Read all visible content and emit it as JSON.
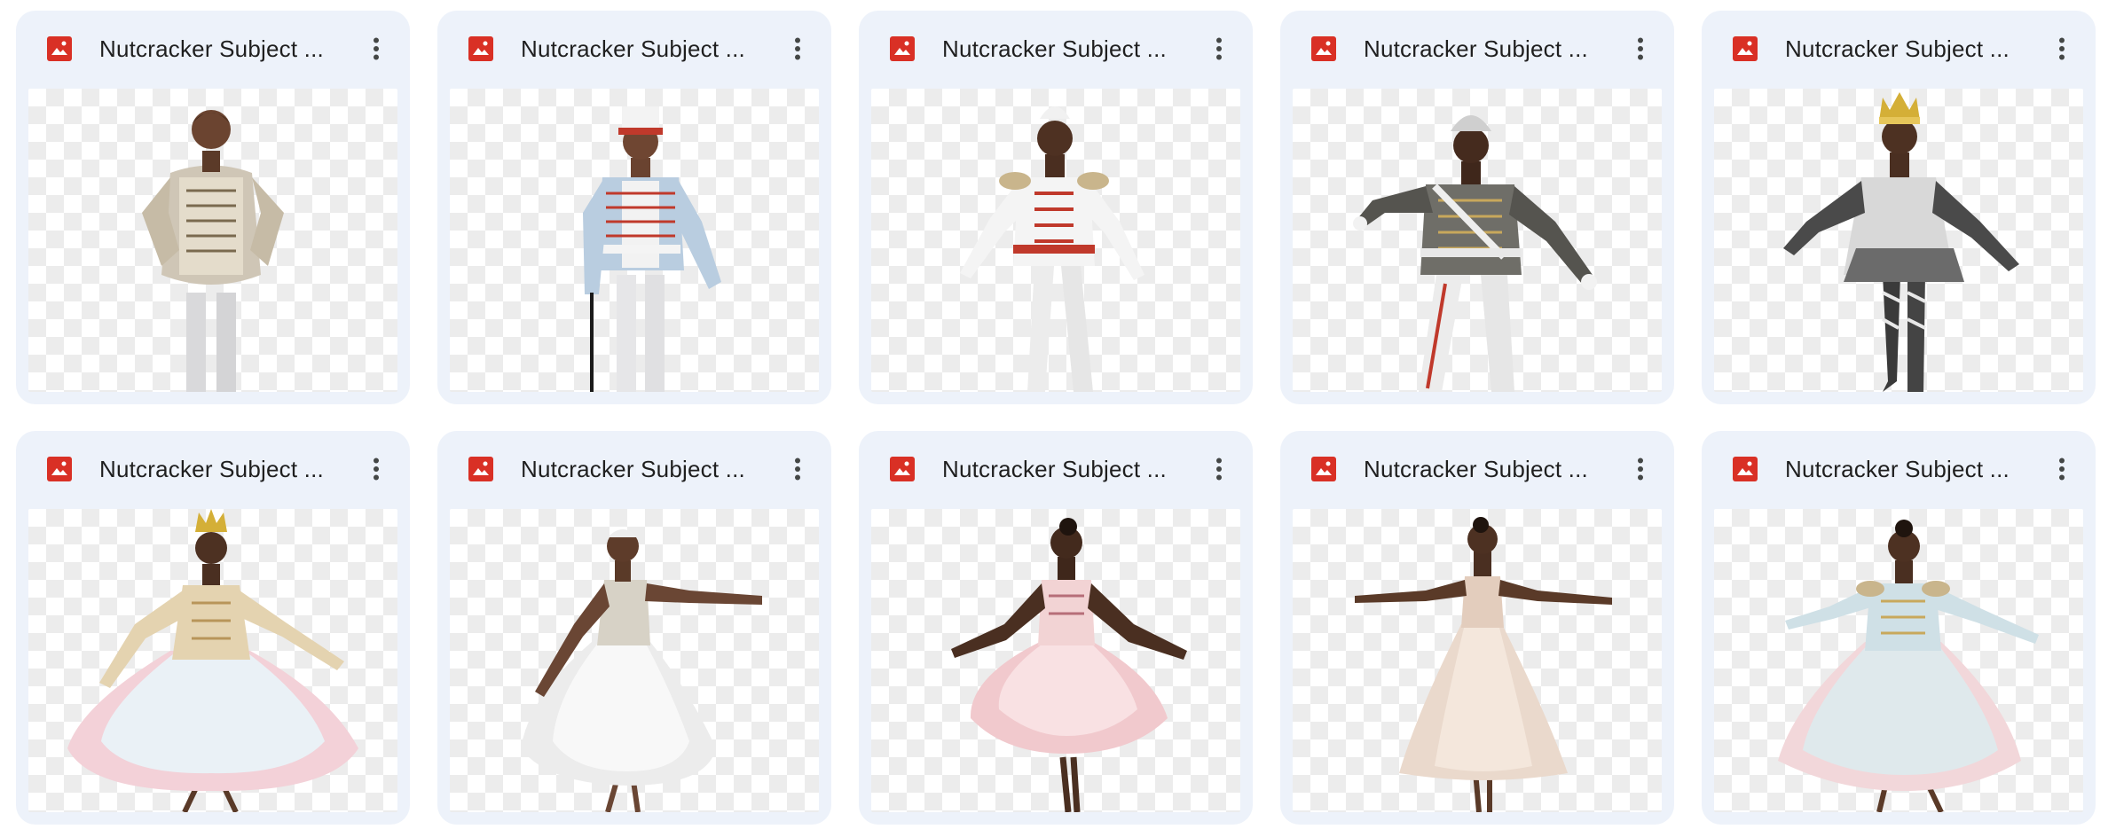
{
  "files": [
    {
      "title": "Nutcracker Subject ...",
      "icon": "image-file-icon",
      "figure": "boy-cream-jacket"
    },
    {
      "title": "Nutcracker Subject ...",
      "icon": "image-file-icon",
      "figure": "boy-soldier-blue-cane"
    },
    {
      "title": "Nutcracker Subject ...",
      "icon": "image-file-icon",
      "figure": "boy-red-white-uniform"
    },
    {
      "title": "Nutcracker Subject ...",
      "icon": "image-file-icon",
      "figure": "boy-grey-gold-uniform"
    },
    {
      "title": "Nutcracker Subject ...",
      "icon": "image-file-icon",
      "figure": "boy-crown-striped"
    },
    {
      "title": "Nutcracker Subject ...",
      "icon": "image-file-icon",
      "figure": "girl-crown-pink-dress"
    },
    {
      "title": "Nutcracker Subject ...",
      "icon": "image-file-icon",
      "figure": "girl-white-tutu"
    },
    {
      "title": "Nutcracker Subject ...",
      "icon": "image-file-icon",
      "figure": "girl-pink-tutu"
    },
    {
      "title": "Nutcracker Subject ...",
      "icon": "image-file-icon",
      "figure": "girl-beige-dress"
    },
    {
      "title": "Nutcracker Subject ...",
      "icon": "image-file-icon",
      "figure": "girl-blue-jacket-dress"
    }
  ],
  "colors": {
    "card_bg": "#edf2fa",
    "icon_red": "#d93025",
    "title_text": "#1f1f1f",
    "more_icon": "#444746"
  },
  "icons": {
    "more": "more-vert-icon"
  }
}
